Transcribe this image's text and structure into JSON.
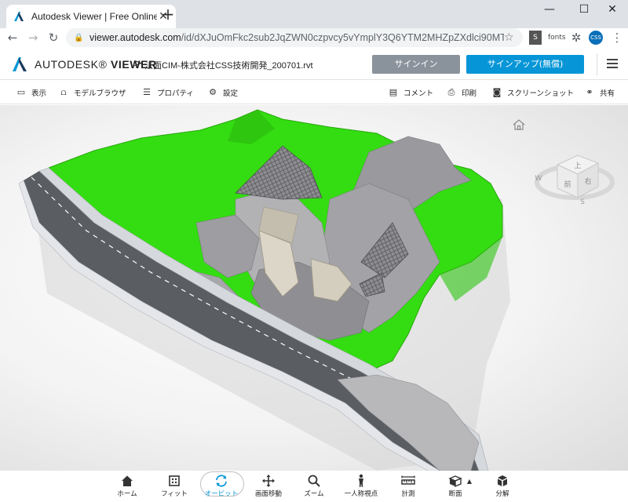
{
  "browser": {
    "tab_title": "Autodesk Viewer | Free Online Fil",
    "url_host": "viewer.autodesk.com",
    "url_path": "/id/dXJuOmFkc2sub2JqZWN0czpvcy5vYmplY3Q6YTM2MHZpZXdlci90MTU5MzU3OD...",
    "ext_fonts": "fonts",
    "ext_css": "CSS",
    "ext_s": "S"
  },
  "app": {
    "brand_light": "AUTODESK",
    "brand_bold": "VIEWER",
    "breadcrumb_sep": ">",
    "filename": "法面CIM-株式会社CSS技術開発_200701.rvt",
    "signin_label": "サインイン",
    "signup_label": "サインアップ(無償)",
    "brand_color": "#0696d7"
  },
  "viewer_toolbar": {
    "left": [
      {
        "icon": "monitor-icon",
        "label": "表示"
      },
      {
        "icon": "model-tree-icon",
        "label": "モデルブラウザ"
      },
      {
        "icon": "properties-icon",
        "label": "プロパティ"
      },
      {
        "icon": "gear-icon",
        "label": "設定"
      }
    ],
    "right": [
      {
        "icon": "comment-icon",
        "label": "コメント"
      },
      {
        "icon": "print-icon",
        "label": "印刷"
      },
      {
        "icon": "camera-icon",
        "label": "スクリーンショット"
      },
      {
        "icon": "share-icon",
        "label": "共有"
      }
    ]
  },
  "viewcube": {
    "top_face": "上",
    "front_face": "前",
    "right_face": "右",
    "compass_w": "W",
    "compass_s": "S"
  },
  "bottom_toolbar": {
    "items": [
      {
        "icon": "home-icon",
        "label": "ホーム",
        "active": false
      },
      {
        "icon": "fit-icon",
        "label": "フィット",
        "active": false
      },
      {
        "icon": "orbit-icon",
        "label": "オービット",
        "active": true
      },
      {
        "icon": "pan-icon",
        "label": "画面移動",
        "active": false
      },
      {
        "icon": "zoom-icon",
        "label": "ズーム",
        "active": false
      },
      {
        "icon": "first-person-icon",
        "label": "一人称視点",
        "active": false
      },
      {
        "icon": "measure-icon",
        "label": "計測",
        "active": false
      },
      {
        "icon": "section-icon",
        "label": "断面",
        "active": false
      },
      {
        "icon": "explode-icon",
        "label": "分解",
        "active": false
      }
    ]
  },
  "colors": {
    "terrain_green": "#33dd11",
    "structure_gray": "#a9a9ab",
    "road_gray": "#5a5d62"
  }
}
